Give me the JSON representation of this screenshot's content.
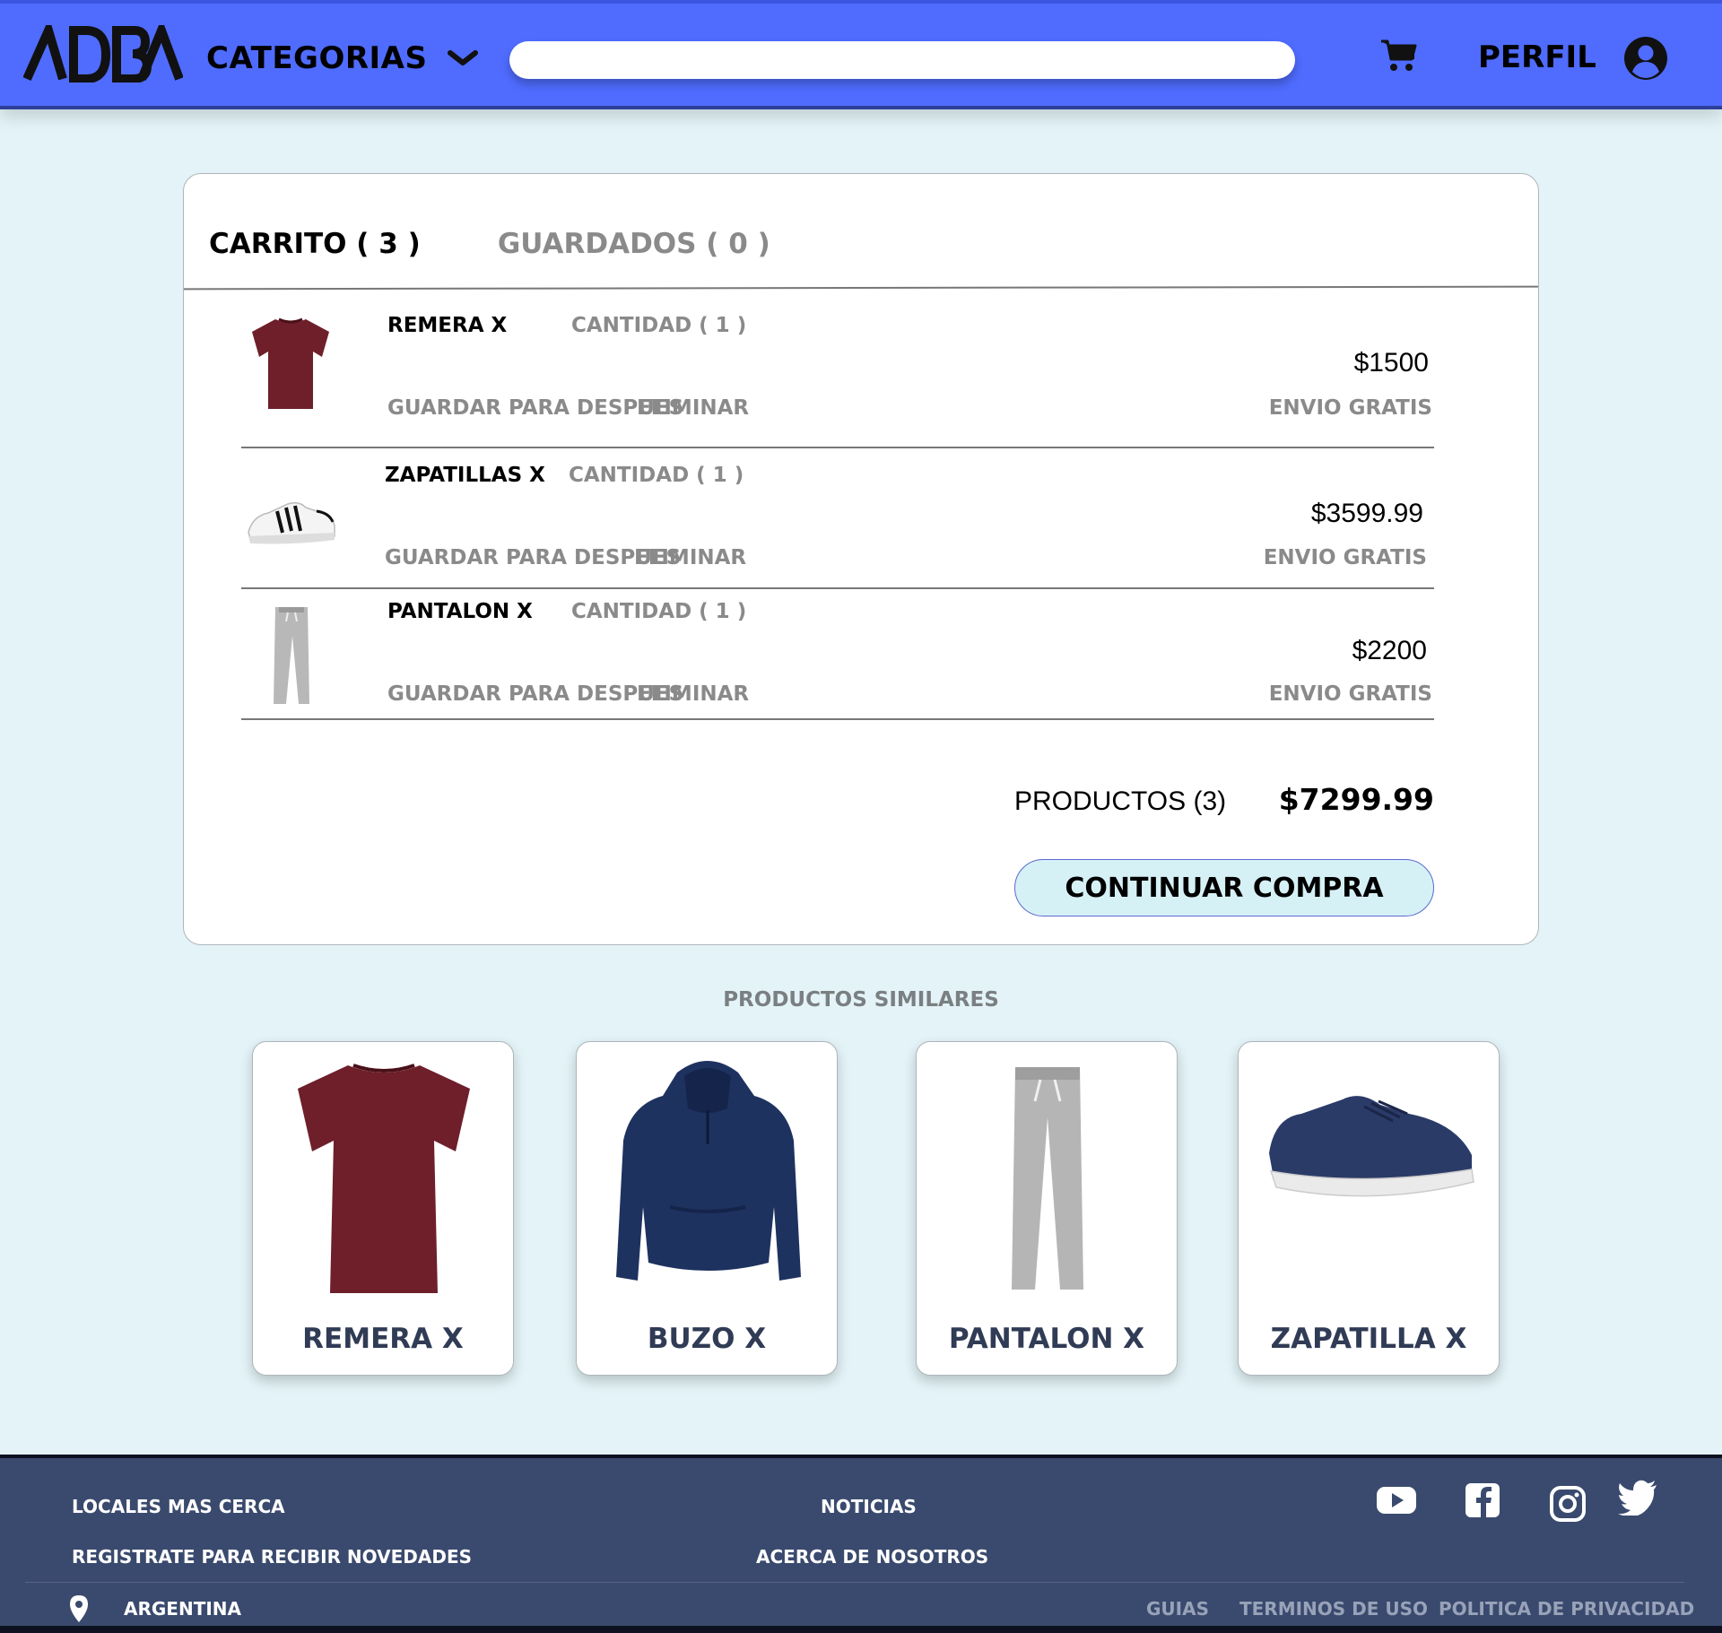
{
  "header": {
    "logo_text": "ADBA",
    "categories_label": "CATEGORIAS",
    "search_placeholder": "",
    "profile_label": "PERFIL",
    "icons": [
      "chevron-down-icon",
      "cart-icon",
      "user-circle-icon"
    ],
    "colors": {
      "bar": "#4f6cff"
    }
  },
  "cart": {
    "tabs": [
      {
        "label": "CARRITO ( 3 )",
        "active": true
      },
      {
        "label": "GUARDADOS ( 0 )",
        "active": false
      }
    ],
    "items": [
      {
        "name": "REMERA X",
        "quantity": "CANTIDAD ( 1 )",
        "save_label": "GUARDAR PARA DESPUES",
        "remove_label": "ELIMINAR",
        "price": "$1500",
        "shipping": "ENVIO GRATIS",
        "image": "tshirt"
      },
      {
        "name": "ZAPATILLAS X",
        "quantity": "CANTIDAD ( 1 )",
        "save_label": "GUARDAR PARA DESPUES",
        "remove_label": "ELIMINAR",
        "price": "$3599.99",
        "shipping": "ENVIO GRATIS",
        "image": "sneaker"
      },
      {
        "name": "PANTALON X",
        "quantity": "CANTIDAD ( 1 )",
        "save_label": "GUARDAR PARA DESPUES",
        "remove_label": "ELIMINAR",
        "price": "$2200",
        "shipping": "ENVIO GRATIS",
        "image": "pants"
      }
    ],
    "summary_label": "PRODUCTOS (3)",
    "summary_total": "$7299.99",
    "continue_label": "CONTINUAR COMPRA"
  },
  "similar": {
    "title": "PRODUCTOS SIMILARES",
    "products": [
      {
        "label": "REMERA X",
        "image": "tshirt"
      },
      {
        "label": "BUZO X",
        "image": "hoodie"
      },
      {
        "label": "PANTALON X",
        "image": "pants"
      },
      {
        "label": "ZAPATILLA X",
        "image": "sneaker"
      }
    ]
  },
  "footer": {
    "links": {
      "nearest_stores": "LOCALES MAS CERCA",
      "newsletter": "REGISTRATE PARA RECIBIR NOVEDADES",
      "news": "NOTICIAS",
      "about": "ACERCA DE NOSOTROS"
    },
    "social_icons": [
      "youtube-icon",
      "facebook-icon",
      "instagram-icon",
      "twitter-icon"
    ],
    "country": "ARGENTINA",
    "legal": {
      "guides": "GUIAS",
      "terms": "TERMINOS DE USO",
      "privacy": "POLITICA DE PRIVACIDAD"
    },
    "colors": {
      "background": "#3a4a6e"
    }
  }
}
